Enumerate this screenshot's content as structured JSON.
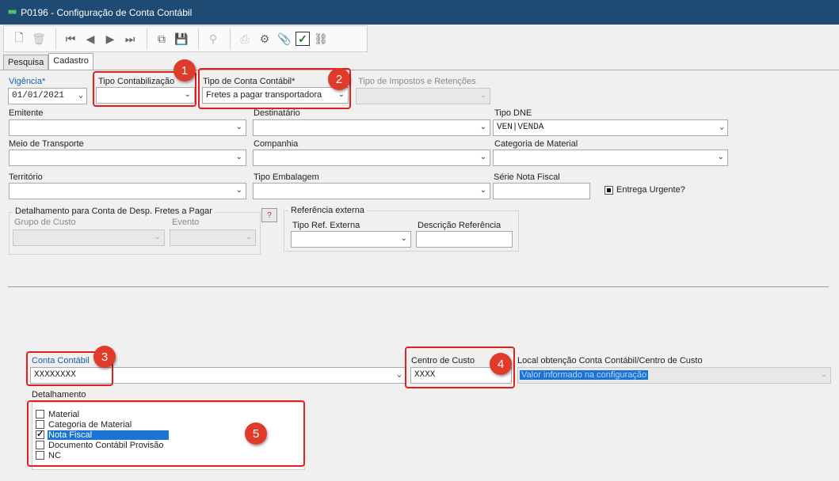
{
  "window": {
    "title": "P0196 - Configuração de Conta Contábil"
  },
  "tabs": [
    {
      "label": "Pesquisa"
    },
    {
      "label": "Cadastro"
    }
  ],
  "form": {
    "vigencia": {
      "label": "Vigência*",
      "value": "01/01/2021"
    },
    "tipo_contabilizacao": {
      "label": "Tipo Contabilização",
      "value": ""
    },
    "tipo_conta_contabil": {
      "label": "Tipo de Conta Contábil*",
      "value": "Fretes a pagar transportadora"
    },
    "tipo_impostos": {
      "label": "Tipo de Impostos e Retenções",
      "value": ""
    },
    "emitente": {
      "label": "Emitente",
      "value": ""
    },
    "destinatario": {
      "label": "Destinatário",
      "value": ""
    },
    "tipo_dne": {
      "label": "Tipo DNE",
      "value": "VEN|VENDA"
    },
    "meio_transporte": {
      "label": "Meio de Transporte",
      "value": ""
    },
    "companhia": {
      "label": "Companhia",
      "value": ""
    },
    "categoria_material": {
      "label": "Categoria de Material",
      "value": ""
    },
    "territorio": {
      "label": "Território",
      "value": ""
    },
    "tipo_embalagem": {
      "label": "Tipo Embalagem",
      "value": ""
    },
    "serie_nota_fiscal": {
      "label": "Série Nota Fiscal",
      "value": ""
    },
    "entrega_urgente": {
      "label": "Entrega Urgente?",
      "checked": true
    },
    "detalhamento_desp": {
      "title": "Detalhamento para Conta de Desp. Fretes a Pagar",
      "grupo_custo": {
        "label": "Grupo de Custo",
        "value": ""
      },
      "evento": {
        "label": "Evento",
        "value": ""
      },
      "help_label": "?"
    },
    "referencia_externa": {
      "title": "Referência externa",
      "tipo_ref": {
        "label": "Tipo Ref. Externa",
        "value": ""
      },
      "descricao": {
        "label": "Descrição Referência",
        "value": ""
      }
    },
    "conta_contabil": {
      "label": "Conta Contábil",
      "value": "XXXXXXXX"
    },
    "centro_custo": {
      "label": "Centro de Custo",
      "value": "XXXX"
    },
    "local_obtencao": {
      "label": "Local obtenção Conta Contábil/Centro de Custo",
      "value": "Valor informado na configuração"
    },
    "detalhamento": {
      "label": "Detalhamento",
      "items": [
        {
          "label": "Material",
          "checked": false,
          "selected": false
        },
        {
          "label": "Categoria de Material",
          "checked": false,
          "selected": false
        },
        {
          "label": "Nota Fiscal",
          "checked": true,
          "selected": true
        },
        {
          "label": "Documento Contábil Provisão",
          "checked": false,
          "selected": false
        },
        {
          "label": "NC",
          "checked": false,
          "selected": false
        }
      ]
    }
  },
  "annotations": {
    "b1": "1",
    "b2": "2",
    "b3": "3",
    "b4": "4",
    "b5": "5"
  },
  "colors": {
    "titlebar": "#1e4a73",
    "annotation": "#e02020",
    "selection": "#1a74d4"
  }
}
